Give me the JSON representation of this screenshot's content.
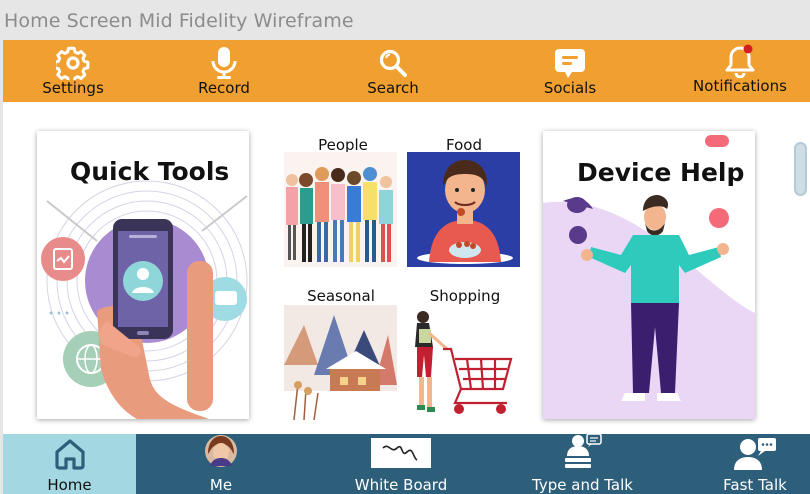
{
  "window_title": "Home Screen Mid Fidelity Wireframe",
  "colors": {
    "top_bar": "#f0a030",
    "bottom_bar": "#2d5f7a",
    "active_tab": "#a3d8e2",
    "notification_dot": "#d32020"
  },
  "top_nav": {
    "settings": {
      "label": "Settings",
      "icon": "gear-icon"
    },
    "record": {
      "label": "Record",
      "icon": "microphone-icon"
    },
    "search": {
      "label": "Search",
      "icon": "magnifier-icon"
    },
    "socials": {
      "label": "Socials",
      "icon": "chat-bubble-icon"
    },
    "notifications": {
      "label": "Notifications",
      "icon": "bell-icon"
    }
  },
  "main": {
    "quick_tools": {
      "title": "Quick Tools"
    },
    "device_help": {
      "title": "Device Help"
    },
    "categories": {
      "people": "People",
      "food": "Food",
      "seasonal": "Seasonal",
      "shopping": "Shopping"
    }
  },
  "bottom_nav": {
    "home": {
      "label": "Home",
      "icon": "house-icon"
    },
    "me": {
      "label": "Me",
      "icon": "avatar"
    },
    "whiteboard": {
      "label": "White Board",
      "icon": "whiteboard-icon"
    },
    "type_talk": {
      "label": "Type and Talk",
      "icon": "person-keyboard-icon"
    },
    "fast_talk": {
      "label": "Fast Talk",
      "icon": "person-speech-icon"
    }
  }
}
